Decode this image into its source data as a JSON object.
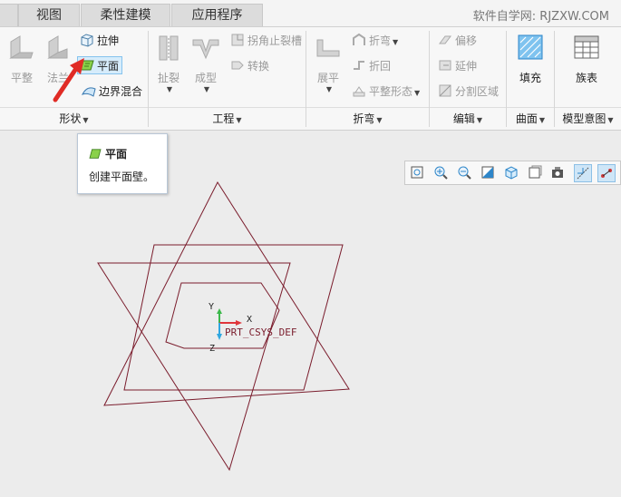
{
  "tabs": [
    {
      "label": "视图"
    },
    {
      "label": "柔性建模"
    },
    {
      "label": "应用程序"
    }
  ],
  "site": {
    "label": "软件自学网: RJZXW.COM"
  },
  "ribbon": {
    "shape": {
      "footer": "形状",
      "flat_label": "平整",
      "flange_label": "法兰",
      "extrude_label": "拉伸",
      "planar_label": "平面",
      "boundary_blend_label": "边界混合"
    },
    "engineering": {
      "footer": "工程",
      "rip_label": "扯裂",
      "form_label": "成型",
      "corner_relief_label": "拐角止裂槽",
      "convert_label": "转换"
    },
    "bends": {
      "footer": "折弯",
      "unbend_label": "展平",
      "bend_label": "折弯",
      "bend_back_label": "折回",
      "flatten_form_label": "平整形态"
    },
    "editing": {
      "footer": "编辑",
      "offset_label": "偏移",
      "extend_label": "延伸",
      "split_area_label": "分割区域"
    },
    "surfaces": {
      "footer": "曲面",
      "fill_label": "填充"
    },
    "model_intent": {
      "footer": "模型意图",
      "family_table_label": "族表"
    }
  },
  "tooltip": {
    "title": "平面",
    "description": "创建平面壁。"
  },
  "csys": {
    "name": "PRT_CSYS_DEF",
    "x_label": "X",
    "y_label": "Y",
    "z_label": "Z"
  },
  "view_toolbar": {
    "icons": [
      "refit-icon",
      "zoom-in-icon",
      "zoom-out-icon",
      "repaint-icon",
      "display-style-icon",
      "saved-orientations-icon",
      "view-manager-icon",
      "datum-display-icon",
      "spin-center-icon"
    ]
  },
  "colors": {
    "sketch_line": "#7a1c2c",
    "csys_x": "#e0353a",
    "csys_y": "#3bb84a",
    "csys_z": "#2fa7e0",
    "arrow": "#e02b25",
    "accent": "#2e86c9"
  }
}
